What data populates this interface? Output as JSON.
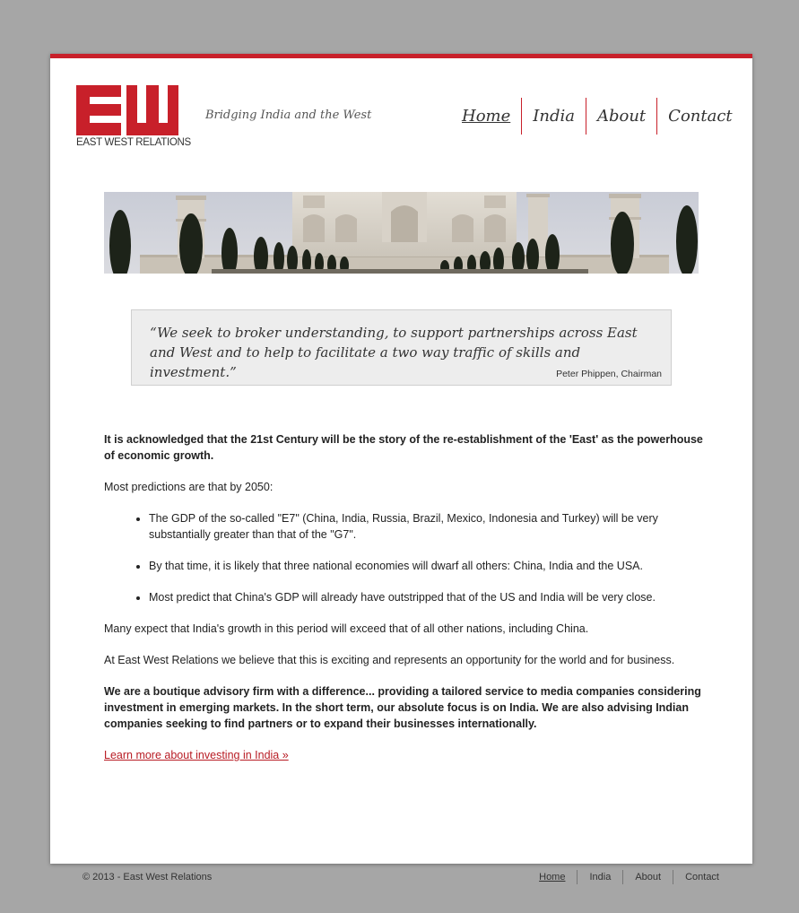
{
  "brand": {
    "logo_letters": "EW",
    "name": "EAST WEST RELATIONS",
    "tagline": "Bridging India and the West",
    "color": "#c8202a"
  },
  "nav": {
    "items": [
      {
        "label": "Home",
        "active": true
      },
      {
        "label": "India",
        "active": false
      },
      {
        "label": "About",
        "active": false
      },
      {
        "label": "Contact",
        "active": false
      }
    ]
  },
  "banner": {
    "subject": "Taj Mahal with cypress trees"
  },
  "quote": {
    "text": "“We seek to broker understanding, to support partnerships across East and West and to help to facilitate a two way traffic of skills and investment.”",
    "author": "Peter Phippen, Chairman"
  },
  "content": {
    "intro": "It is acknowledged that the 21st Century will be the story of the re-establishment of the 'East' as the powerhouse of economic growth.",
    "predictions_lead": "Most predictions are that by 2050:",
    "bullets": [
      "The GDP of the so-called \"E7\" (China, India, Russia, Brazil, Mexico, Indonesia and Turkey) will be very substantially greater than that of the \"G7\".",
      "By that time, it is likely that three national economies will dwarf all others: China, India and the USA.",
      "Most predict that China's GDP will already have outstripped that of the US and India will be very close."
    ],
    "growth": "Many expect that India's growth in this period will exceed that of all other nations, including China.",
    "belief": "At East West Relations we believe that this is exciting and represents an opportunity for the world and for business.",
    "boutique": "We are a boutique advisory firm with a difference... providing a tailored service to media companies considering investment in emerging markets. In the short term, our absolute focus is on India. We are also advising Indian companies seeking to find partners or to expand their businesses internationally.",
    "link": "Learn more about investing in India »"
  },
  "footer": {
    "copyright": "© 2013 - East West Relations",
    "nav": [
      "Home",
      "India",
      "About",
      "Contact"
    ]
  }
}
